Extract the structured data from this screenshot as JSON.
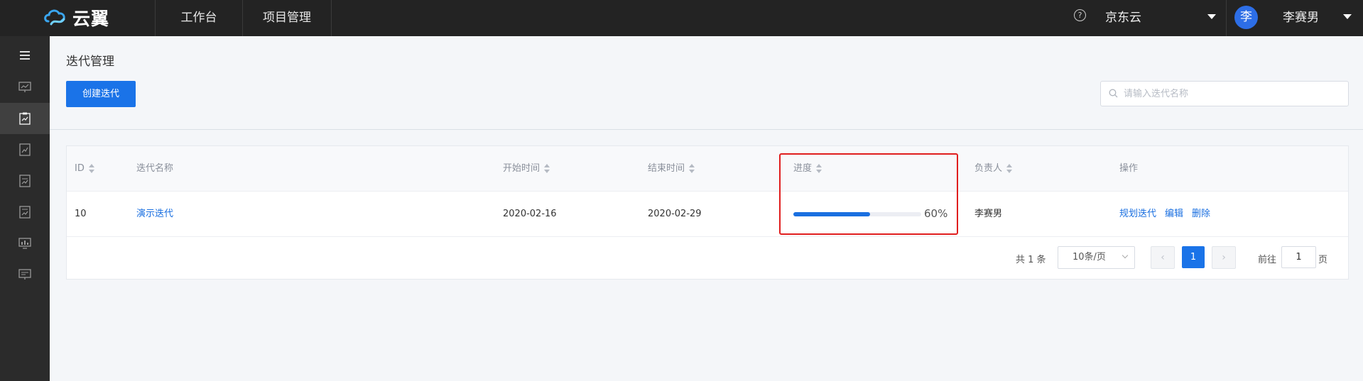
{
  "header": {
    "logo_text": "云翼",
    "nav": [
      "工作台",
      "项目管理"
    ],
    "help_glyph": "?",
    "region": "京东云",
    "avatar_initial": "李",
    "user_name": "李赛男"
  },
  "sidebar": {
    "icons": [
      "menu-icon",
      "dashboard-icon",
      "iteration-icon",
      "report-icon",
      "document-icon",
      "file-icon",
      "monitor-icon",
      "screen-icon"
    ],
    "active_index": 2
  },
  "page": {
    "title": "迭代管理",
    "create_button": "创建迭代",
    "search_placeholder": "请输入迭代名称"
  },
  "table": {
    "columns": [
      "ID",
      "迭代名称",
      "开始时间",
      "结束时间",
      "进度",
      "负责人",
      "操作"
    ],
    "rows": [
      {
        "id": "10",
        "name": "演示迭代",
        "start": "2020-02-16",
        "end": "2020-02-29",
        "progress": 0.6,
        "progress_text": "60%",
        "owner": "李赛男",
        "actions": [
          "规划迭代",
          "编辑",
          "删除"
        ]
      }
    ]
  },
  "pagination": {
    "total": "共 1 条",
    "page_size": "10条/页",
    "current_page": "1",
    "prev_glyph": "‹",
    "next_glyph": "›",
    "goto_label": "前往",
    "goto_value": "1",
    "goto_suffix": "页"
  },
  "colors": {
    "accent": "#1a73e8",
    "topbar": "#232323",
    "sidebar": "#2b2b2b",
    "highlight": "#e01e1e"
  }
}
